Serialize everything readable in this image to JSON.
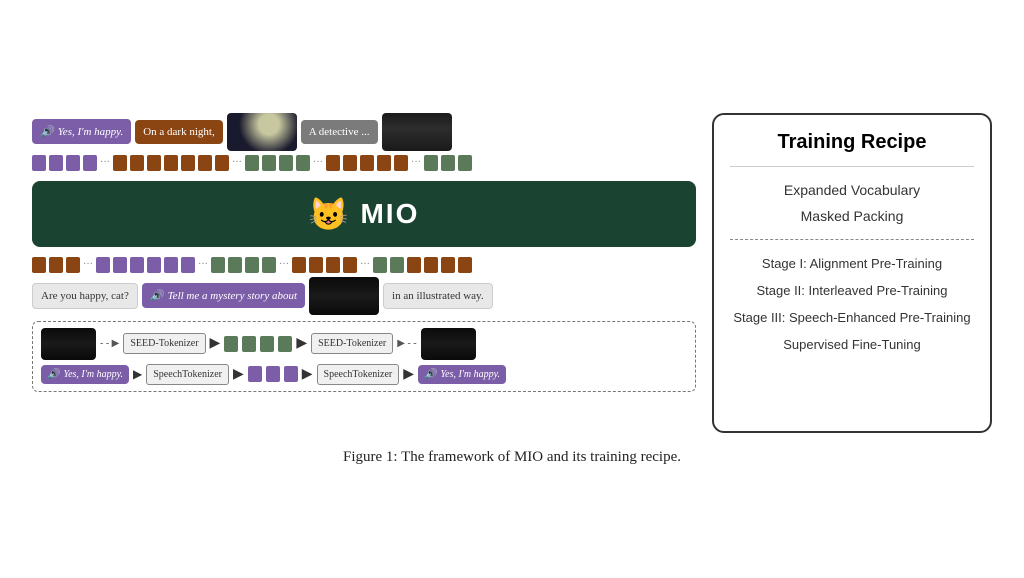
{
  "figure": {
    "caption": "Figure 1: The framework of MIO and its training recipe."
  },
  "diagram": {
    "input_speech": "Yes, I'm happy.",
    "input_text1": "On a dark night,",
    "input_text2": "A detective ...",
    "mio_label": "MIO",
    "mio_cat_emoji": "🐱",
    "output_text1": "Are you happy, cat?",
    "output_speech": "Tell me a mystery story about",
    "output_text2": "in an illustrated way.",
    "tokenizer1": "SEED-Tokenizer",
    "tokenizer2": "SpeechTokenizer",
    "yes_happy": "Yes, I'm happy."
  },
  "recipe": {
    "title": "Training Recipe",
    "items_top": [
      "Expanded Vocabulary",
      "Masked Packing"
    ],
    "items_bottom": [
      "Stage I: Alignment Pre-Training",
      "Stage II: Interleaved Pre-Training",
      "Stage III: Speech-Enhanced Pre-Training",
      "Supervised Fine-Tuning"
    ]
  }
}
